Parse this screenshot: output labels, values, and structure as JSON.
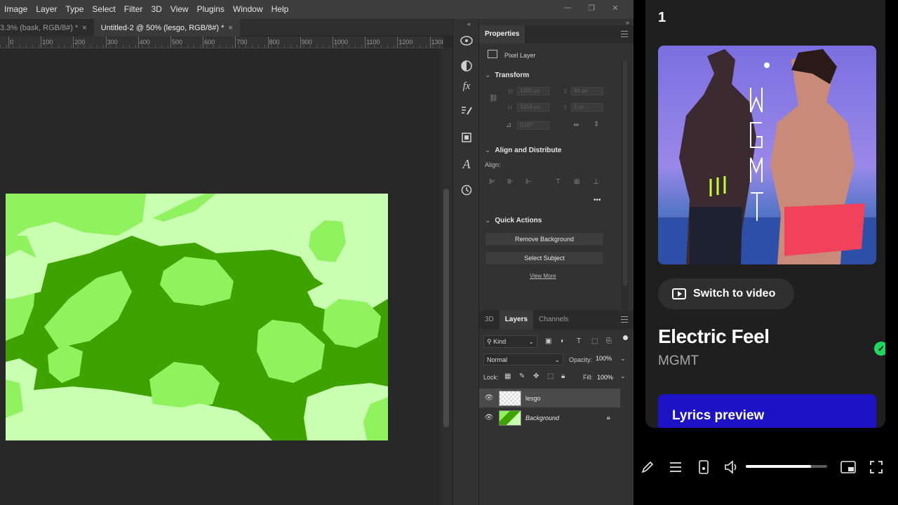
{
  "menubar": {
    "items": [
      "Image",
      "Layer",
      "Type",
      "Select",
      "Filter",
      "3D",
      "View",
      "Plugins",
      "Window",
      "Help"
    ]
  },
  "window_controls": {
    "minimize": "—",
    "restore": "❐",
    "close": "✕"
  },
  "document_tabs": [
    {
      "label": "3.3% (bask, RGB/8#) *",
      "close": "×"
    },
    {
      "label": "Untitled-2 @ 50% (lesgo, RGB/8#) *",
      "close": "×"
    }
  ],
  "ruler": {
    "ticks": [
      "0",
      "100",
      "200",
      "300",
      "400",
      "500",
      "600",
      "700",
      "800",
      "900",
      "1000",
      "1100",
      "1200",
      "1300"
    ]
  },
  "colors": {
    "dark_green": "#3ea200",
    "mid_green": "#8ff25e",
    "light_green": "#c9ffb0",
    "spotify_green": "#1ed760",
    "lyrics_blue": "#1e12c5"
  },
  "toolstrip": {
    "icons": [
      "3d-sphere-icon",
      "adjustments-icon",
      "fx-icon",
      "brush-settings-icon",
      "library-icon",
      "character-icon",
      "history-icon"
    ]
  },
  "properties": {
    "tab": "Properties",
    "layer_type": "Pixel Layer",
    "transform": {
      "title": "Transform",
      "w_label": "W",
      "w_value": "1995 px",
      "h_label": "H",
      "h_value": "1954 px",
      "x_label": "X",
      "x_value": "84 px",
      "y_label": "Y",
      "y_value": "0 px",
      "angle_value": "0.00°"
    },
    "align": {
      "title": "Align and Distribute",
      "label": "Align:"
    },
    "quick_actions": {
      "title": "Quick Actions",
      "remove_bg": "Remove Background",
      "select_subject": "Select Subject",
      "view_more": "View More"
    }
  },
  "layers_panel": {
    "tabs": [
      "3D",
      "Layers",
      "Channels"
    ],
    "filter_kind": "Kind",
    "blend_mode": "Normal",
    "opacity_label": "Opacity:",
    "opacity_value": "100%",
    "lock_label": "Lock:",
    "fill_label": "Fill:",
    "fill_value": "100%",
    "layers": [
      {
        "name": "lesgo",
        "selected": true
      },
      {
        "name": "Background",
        "selected": false,
        "locked": true
      }
    ]
  },
  "music": {
    "queue_number": "1",
    "switch_label": "Switch to video",
    "song_title": "Electric Feel",
    "artist": "MGMT",
    "lyrics_label": "Lyrics preview",
    "album_text": "MGMT",
    "volume": 0.8
  }
}
